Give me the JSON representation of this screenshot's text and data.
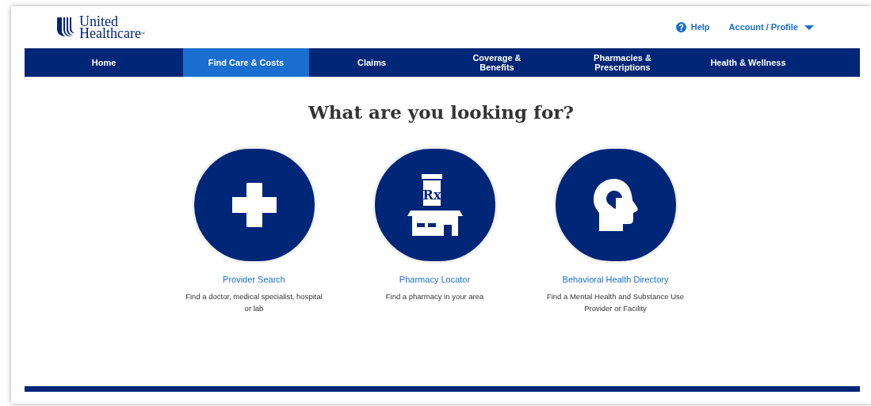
{
  "logo": {
    "line_1": "United",
    "line_2": "Healthcare",
    "mark": "®"
  },
  "header_links": [
    {
      "kind": "help",
      "label": "Help"
    },
    {
      "kind": "menu",
      "label": "Account / Profile"
    }
  ],
  "nav": [
    {
      "label": "Home",
      "selected": false
    },
    {
      "label": "Find Care & Costs",
      "selected": true
    },
    {
      "label": "Claims",
      "selected": false
    },
    {
      "label": "Coverage & Benefits",
      "selected": false
    },
    {
      "label": "Pharmacies & Prescriptions",
      "selected": false
    },
    {
      "label": "Health & Wellness",
      "selected": false
    }
  ],
  "heading": "What are you looking for?",
  "options": [
    {
      "kind": "cross",
      "title": "Provider Search",
      "description": "Find a doctor, medical specialist, hospital or lab"
    },
    {
      "kind": "pharmacy",
      "icon_text": "Rx",
      "title": "Pharmacy Locator",
      "description": "Find a pharmacy in your area"
    },
    {
      "kind": "head",
      "title": "Behavioral Health Directory",
      "description": "Find a Mental Health and Substance Use Provider or Facility"
    }
  ]
}
